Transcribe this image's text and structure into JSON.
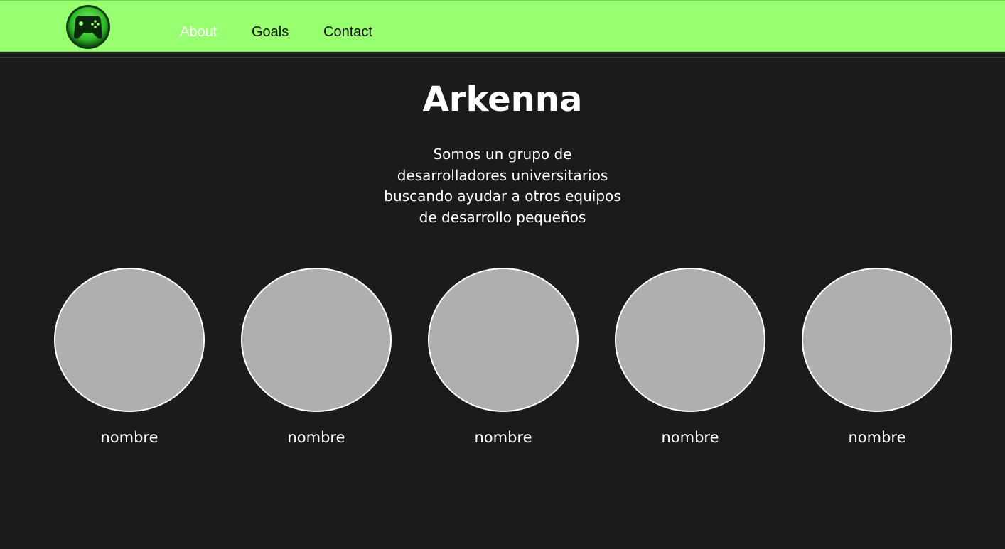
{
  "colors": {
    "nav_background": "#98ff71",
    "page_background": "#1b1b1b",
    "avatar_fill": "#afafaf",
    "active_link": "#ffffff"
  },
  "header": {
    "logo_icon": "gamepad-icon",
    "nav": [
      {
        "label": "About",
        "active": true
      },
      {
        "label": "Goals",
        "active": false
      },
      {
        "label": "Contact",
        "active": false
      }
    ]
  },
  "main": {
    "title": "Arkenna",
    "intro": "Somos un grupo de desarrolladores universitarios buscando ayudar a otros equipos de desarrollo pequeños",
    "team": [
      {
        "name": "nombre"
      },
      {
        "name": "nombre"
      },
      {
        "name": "nombre"
      },
      {
        "name": "nombre"
      },
      {
        "name": "nombre"
      }
    ]
  }
}
